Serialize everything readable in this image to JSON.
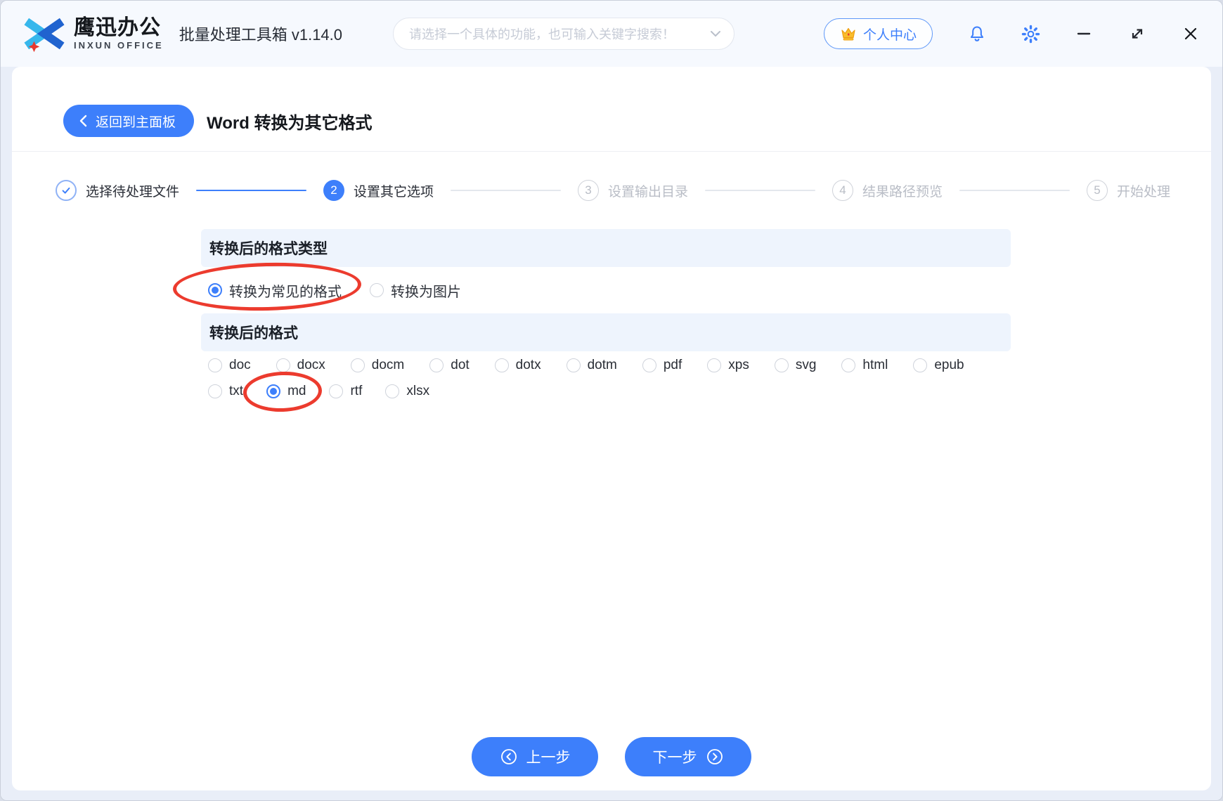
{
  "topbar": {
    "brand": {
      "name": "鹰迅办公",
      "sub": "INXUN OFFICE"
    },
    "app_title": "批量处理工具箱 v1.14.0",
    "search_placeholder": "请选择一个具体的功能，也可输入关键字搜索！",
    "user_center_label": "个人中心"
  },
  "header": {
    "back_label": "返回到主面板",
    "page_title": "Word 转换为其它格式"
  },
  "steps": [
    {
      "num": "1",
      "label": "选择待处理文件",
      "state": "done"
    },
    {
      "num": "2",
      "label": "设置其它选项",
      "state": "active"
    },
    {
      "num": "3",
      "label": "设置输出目录",
      "state": "pending"
    },
    {
      "num": "4",
      "label": "结果路径预览",
      "state": "pending"
    },
    {
      "num": "5",
      "label": "开始处理",
      "state": "pending"
    }
  ],
  "sections": {
    "format_type": {
      "title": "转换后的格式类型",
      "options": [
        {
          "label": "转换为常见的格式",
          "selected": true
        },
        {
          "label": "转换为图片",
          "selected": false
        }
      ]
    },
    "format": {
      "title": "转换后的格式",
      "rows": [
        [
          "doc",
          "docx",
          "docm",
          "dot",
          "dotx",
          "dotm",
          "pdf",
          "xps",
          "svg",
          "html",
          "epub"
        ],
        [
          "txt",
          "md",
          "rtf",
          "xlsx"
        ]
      ],
      "selected": "md"
    }
  },
  "footer": {
    "prev_label": "上一步",
    "next_label": "下一步"
  },
  "colors": {
    "accent": "#3D7FFB",
    "annotation": "#EC3B2E",
    "section_bg": "#EEF4FD"
  }
}
